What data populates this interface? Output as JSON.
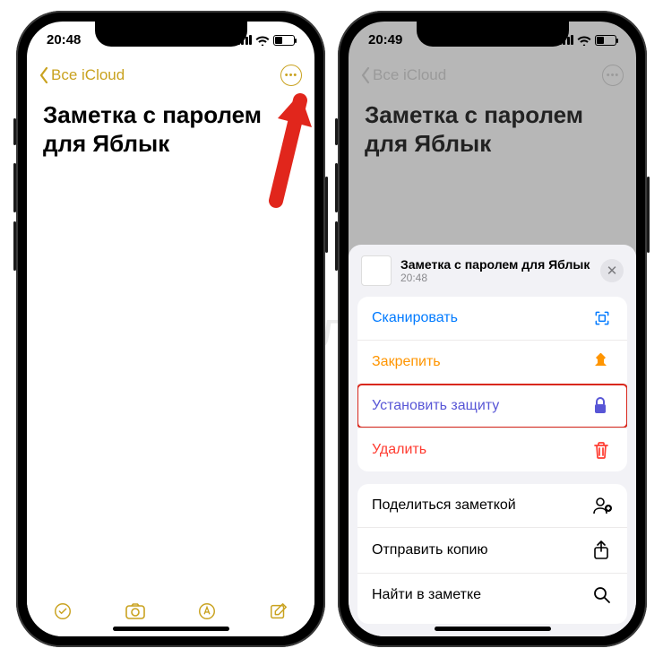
{
  "watermark": "Яблык",
  "left": {
    "time": "20:48",
    "back_label": "Все iCloud",
    "note_title": "Заметка с паролем для Яблык"
  },
  "right": {
    "time": "20:49",
    "back_label": "Все iCloud",
    "note_title": "Заметка с паролем для Яблык",
    "sheet": {
      "title": "Заметка с паролем для Яблык",
      "subtitle": "20:48",
      "actions_primary": [
        {
          "label": "Сканировать",
          "color": "blue",
          "icon": "scan"
        },
        {
          "label": "Закрепить",
          "color": "orange",
          "icon": "pin"
        },
        {
          "label": "Установить защиту",
          "color": "purple",
          "icon": "lock",
          "highlight": true
        },
        {
          "label": "Удалить",
          "color": "red",
          "icon": "trash"
        }
      ],
      "actions_secondary": [
        {
          "label": "Поделиться заметкой",
          "icon": "adduser"
        },
        {
          "label": "Отправить копию",
          "icon": "share"
        },
        {
          "label": "Найти в заметке",
          "icon": "search"
        }
      ]
    }
  }
}
